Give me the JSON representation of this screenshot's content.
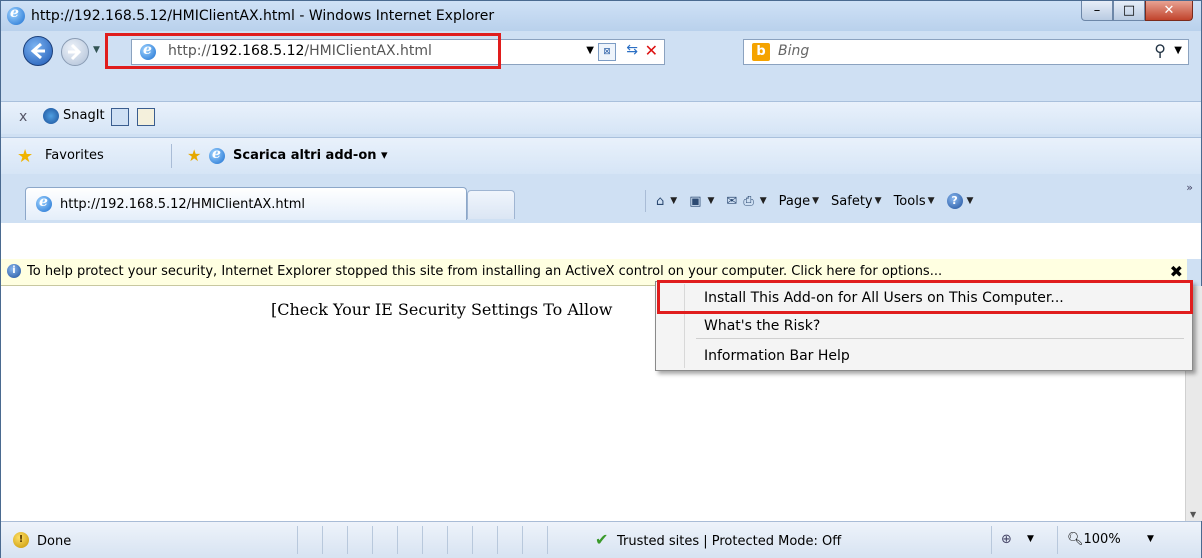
{
  "window": {
    "title": "http://192.168.5.12/HMIClientAX.html - Windows Internet Explorer",
    "controls": {
      "minimize": "–",
      "maximize": "□",
      "close": "✕"
    }
  },
  "address": {
    "url_prefix": "http://",
    "url_host": "192.168.5.12",
    "url_path": "/HMIClientAX.html"
  },
  "search": {
    "placeholder": "Bing"
  },
  "snagit": {
    "close": "x",
    "label": "SnagIt"
  },
  "favorites": {
    "label": "Favorites",
    "addon_link": "Scarica altri add-on ▾"
  },
  "tab": {
    "title": "http://192.168.5.12/HMIClientAX.html"
  },
  "command_bar": {
    "page": "Page",
    "safety": "Safety",
    "tools": "Tools",
    "more": "»"
  },
  "infobar": {
    "text": "To help protect your security, Internet Explorer stopped this site from installing an ActiveX control on your computer. Click here for options...",
    "close": "✖"
  },
  "content": {
    "message": "[Check Your IE Security Settings To Allow"
  },
  "context_menu": {
    "items": [
      "Install This Add-on for All Users on This Computer...",
      "What's the Risk?",
      "Information Bar Help"
    ]
  },
  "status": {
    "text": "Done",
    "zone": "Trusted sites | Protected Mode: Off",
    "zoom": "100%"
  },
  "highlight_color": "#e01d1d"
}
